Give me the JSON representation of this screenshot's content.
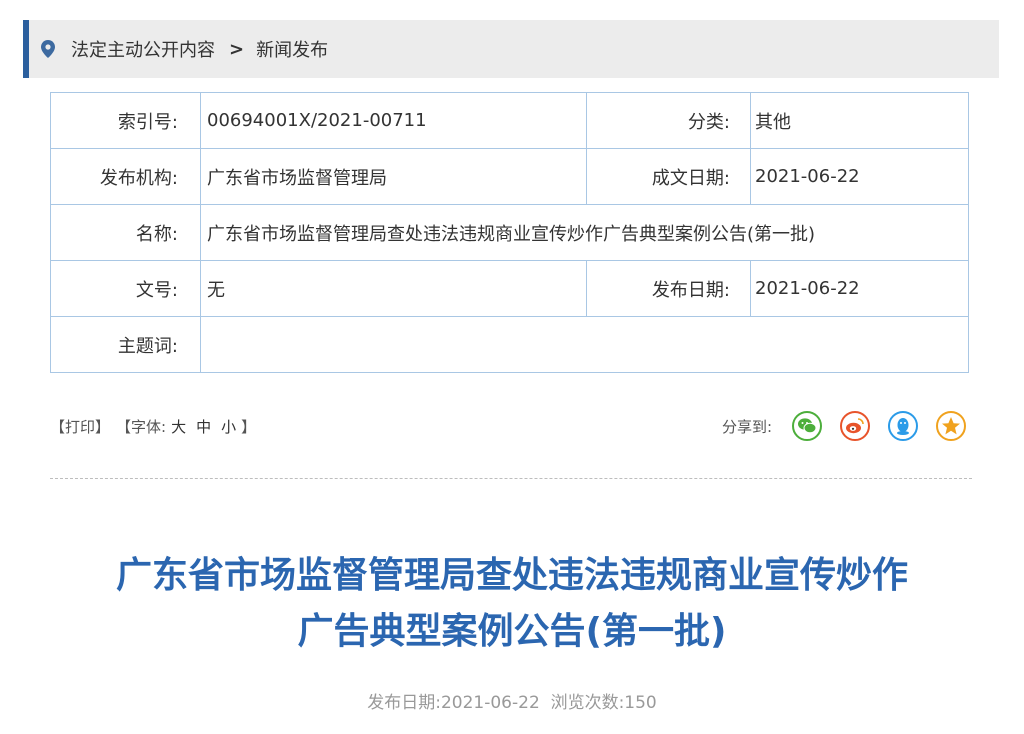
{
  "breadcrumb": {
    "link": "法定主动公开内容",
    "separator": ">",
    "current": "新闻发布"
  },
  "meta": {
    "index_label": "索引号:",
    "index_value": "00694001X/2021-00711",
    "category_label": "分类:",
    "category_value": "其他",
    "org_label": "发布机构:",
    "org_value": "广东省市场监督管理局",
    "created_label": "成文日期:",
    "created_value": "2021-06-22",
    "name_label": "名称:",
    "name_value": "广东省市场监督管理局查处违法违规商业宣传炒作广告典型案例公告(第一批)",
    "docno_label": "文号:",
    "docno_value": "无",
    "published_label": "发布日期:",
    "published_value": "2021-06-22",
    "keywords_label": "主题词:",
    "keywords_value": ""
  },
  "tools": {
    "print": "【打印】",
    "font_prefix": "【字体:",
    "font_large": "大",
    "font_medium": "中",
    "font_small": "小",
    "font_suffix": "】",
    "share_label": "分享到:"
  },
  "share": [
    {
      "name": "wechat-icon",
      "color": "#4cae3b"
    },
    {
      "name": "weibo-icon",
      "color": "#e8542b"
    },
    {
      "name": "qq-icon",
      "color": "#2b9be8"
    },
    {
      "name": "qzone-icon",
      "color": "#f0a21e"
    }
  ],
  "article": {
    "title_line1": "广东省市场监督管理局查处违法违规商业宣传炒作",
    "title_line2": "广告典型案例公告(第一批)",
    "meta_text": "发布日期:2021-06-22  浏览次数:150"
  },
  "colors": {
    "accent": "#2b5f9e",
    "title": "#2b66b0",
    "table_border": "#a9c7e4"
  }
}
